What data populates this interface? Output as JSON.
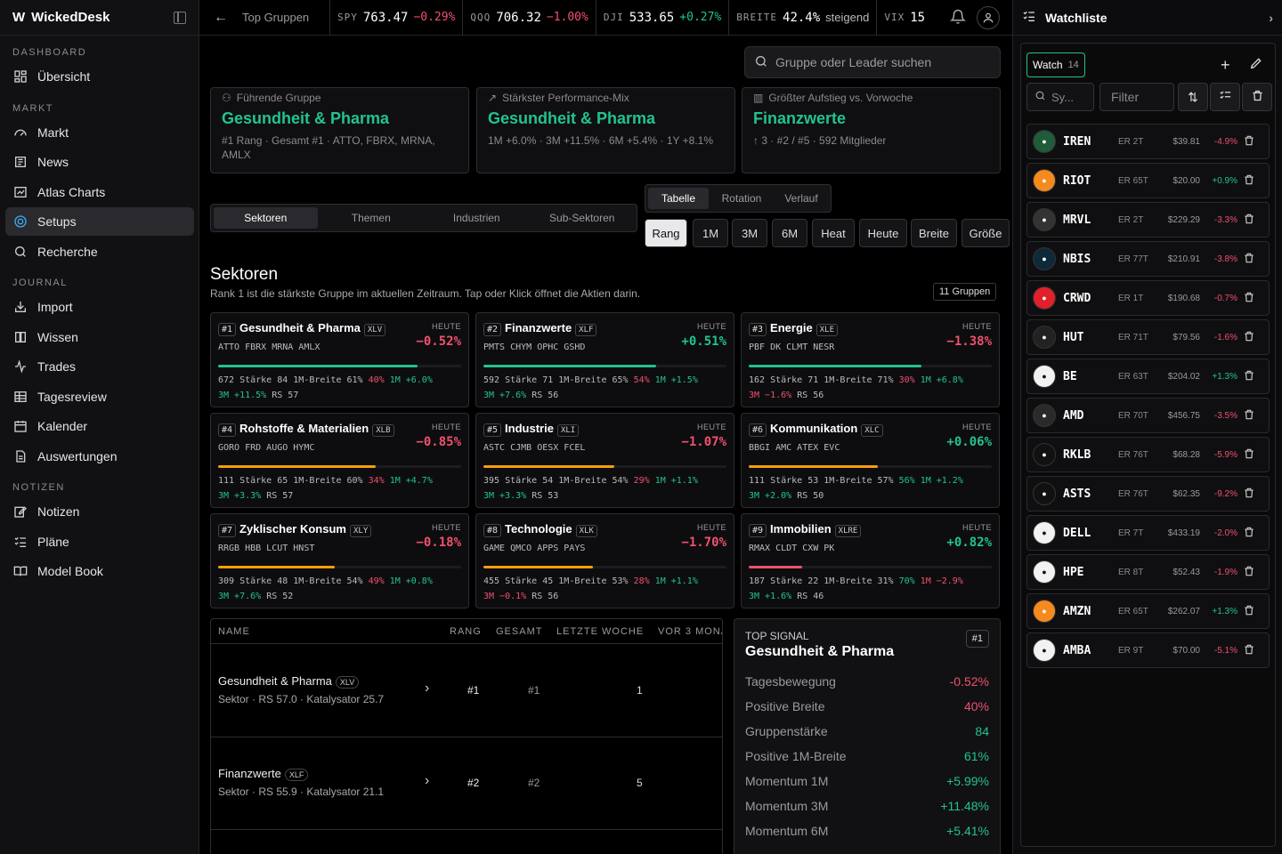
{
  "brand": {
    "name": "WickedDesk"
  },
  "sidebar": {
    "sections": [
      {
        "label": "DASHBOARD"
      },
      {
        "label": "MARKT"
      },
      {
        "label": "JOURNAL"
      },
      {
        "label": "NOTIZEN"
      }
    ],
    "items": [
      {
        "label": "Übersicht",
        "icon": "grid-icon"
      },
      {
        "label": "Markt",
        "icon": "gauge-icon"
      },
      {
        "label": "News",
        "icon": "newspaper-icon"
      },
      {
        "label": "Atlas Charts",
        "icon": "chart-icon"
      },
      {
        "label": "Setups",
        "icon": "target-icon"
      },
      {
        "label": "Recherche",
        "icon": "search-icon"
      },
      {
        "label": "Import",
        "icon": "import-icon"
      },
      {
        "label": "Wissen",
        "icon": "book-icon"
      },
      {
        "label": "Trades",
        "icon": "activity-icon"
      },
      {
        "label": "Tagesreview",
        "icon": "table-icon"
      },
      {
        "label": "Kalender",
        "icon": "calendar-icon"
      },
      {
        "label": "Auswertungen",
        "icon": "file-icon"
      },
      {
        "label": "Notizen",
        "icon": "edit-icon"
      },
      {
        "label": "Pläne",
        "icon": "list-icon"
      },
      {
        "label": "Model Book",
        "icon": "book-open-icon"
      }
    ]
  },
  "topbar": {
    "crumb": "Top Gruppen",
    "tickers": [
      {
        "sym": "SPY",
        "val": "763.47",
        "chg": "−0.29%",
        "dir": "neg"
      },
      {
        "sym": "QQQ",
        "val": "706.32",
        "chg": "−1.00%",
        "dir": "neg"
      },
      {
        "sym": "DJI",
        "val": "533.65",
        "chg": "+0.27%",
        "dir": "pos"
      },
      {
        "sym": "BREITE",
        "val": "42.4%",
        "chg": "steigend",
        "dir": "flat"
      },
      {
        "sym": "VIX",
        "val": "15",
        "chg": "",
        "dir": "flat"
      }
    ]
  },
  "search": {
    "placeholder": "Gruppe oder Leader suchen"
  },
  "highlights": [
    {
      "label": "Führende Gruppe",
      "title": "Gesundheit & Pharma",
      "sub": "#1 Rang · Gesamt #1 · ATTO, FBRX, MRNA, AMLX"
    },
    {
      "label": "Stärkster Performance-Mix",
      "title": "Gesundheit & Pharma",
      "sub": "1M +6.0% · 3M +11.5% · 6M +5.4% · 1Y +8.1%"
    },
    {
      "label": "Größter Aufstieg vs. Vorwoche",
      "title": "Finanzwerte",
      "sub": "↑ 3 · #2 / #5 · 592 Mitglieder"
    }
  ],
  "views": [
    "Tabelle",
    "Rotation",
    "Verlauf"
  ],
  "segments": [
    "Sektoren",
    "Themen",
    "Industrien",
    "Sub-Sektoren"
  ],
  "sorts": [
    "Rang",
    "1M",
    "3M",
    "6M",
    "Heat",
    "Heute",
    "Breite",
    "Größe"
  ],
  "section": {
    "title": "Sektoren",
    "desc": "Rank 1 ist die stärkste Gruppe im aktuellen Zeitraum. Tap oder Klick öffnet die Aktien darin.",
    "count": "11 Gruppen"
  },
  "cards": [
    {
      "rank": "#1",
      "name": "Gesundheit & Pharma",
      "etf": "XLV",
      "leaders": "ATTO FBRX MRNA AMLX",
      "today_label": "HEUTE",
      "chg": "−0.52%",
      "dir": "neg",
      "bar": 0.82,
      "barcol": "#22c38e",
      "l1a": "672 Stärke 84 1M-Breite 61%",
      "l1b": "40%",
      "l1c": "1M +6.0%",
      "l2a": "3M +11.5%",
      "l2b": "RS 57"
    },
    {
      "rank": "#2",
      "name": "Finanzwerte",
      "etf": "XLF",
      "leaders": "PMTS CHYM OPHC GSHD",
      "today_label": "HEUTE",
      "chg": "+0.51%",
      "dir": "pos",
      "bar": 0.71,
      "barcol": "#22c38e",
      "l1a": "592 Stärke 71 1M-Breite 65%",
      "l1b": "54%",
      "l1c": "1M +1.5%",
      "l2a": "3M +7.6%",
      "l2b": "RS 56"
    },
    {
      "rank": "#3",
      "name": "Energie",
      "etf": "XLE",
      "leaders": "PBF DK CLMT NESR",
      "today_label": "HEUTE",
      "chg": "−1.38%",
      "dir": "neg",
      "bar": 0.71,
      "barcol": "#22c38e",
      "l1a": "162 Stärke 71 1M-Breite 71%",
      "l1b": "30%",
      "l1c": "1M +6.8%",
      "l2a": "3M −1.6%",
      "l2b": "RS 56"
    },
    {
      "rank": "#4",
      "name": "Rohstoffe & Materialien",
      "etf": "XLB",
      "leaders": "GORO FRD AUGO HYMC",
      "today_label": "HEUTE",
      "chg": "−0.85%",
      "dir": "neg",
      "bar": 0.65,
      "barcol": "#f59e0b",
      "l1a": "111 Stärke 65 1M-Breite 60%",
      "l1b": "34%",
      "l1c": "1M +4.7%",
      "l2a": "3M +3.3%",
      "l2b": "RS 57"
    },
    {
      "rank": "#5",
      "name": "Industrie",
      "etf": "XLI",
      "leaders": "ASTC CJMB OESX FCEL",
      "today_label": "HEUTE",
      "chg": "−1.07%",
      "dir": "neg",
      "bar": 0.54,
      "barcol": "#f59e0b",
      "l1a": "395 Stärke 54 1M-Breite 54%",
      "l1b": "29%",
      "l1c": "1M +1.1%",
      "l2a": "3M +3.3%",
      "l2b": "RS 53"
    },
    {
      "rank": "#6",
      "name": "Kommunikation",
      "etf": "XLC",
      "leaders": "BBGI AMC ATEX EVC",
      "today_label": "HEUTE",
      "chg": "+0.06%",
      "dir": "pos",
      "bar": 0.53,
      "barcol": "#f59e0b",
      "l1a": "111 Stärke 53 1M-Breite 57%",
      "l1b": "56%",
      "l1c": "1M +1.2%",
      "l2a": "3M +2.0%",
      "l2b": "RS 50"
    },
    {
      "rank": "#7",
      "name": "Zyklischer Konsum",
      "etf": "XLY",
      "leaders": "RRGB HBB LCUT HNST",
      "today_label": "HEUTE",
      "chg": "−0.18%",
      "dir": "neg",
      "bar": 0.48,
      "barcol": "#f59e0b",
      "l1a": "309 Stärke 48 1M-Breite 54%",
      "l1b": "49%",
      "l1c": "1M +0.8%",
      "l2a": "3M +7.6%",
      "l2b": "RS 52"
    },
    {
      "rank": "#8",
      "name": "Technologie",
      "etf": "XLK",
      "leaders": "GAME QMCO APPS PAYS",
      "today_label": "HEUTE",
      "chg": "−1.70%",
      "dir": "neg",
      "bar": 0.45,
      "barcol": "#f59e0b",
      "l1a": "455 Stärke 45 1M-Breite 53%",
      "l1b": "28%",
      "l1c": "1M +1.1%",
      "l2a": "3M −0.1%",
      "l2b": "RS 56"
    },
    {
      "rank": "#9",
      "name": "Immobilien",
      "etf": "XLRE",
      "leaders": "RMAX CLDT CXW PK",
      "today_label": "HEUTE",
      "chg": "+0.82%",
      "dir": "pos",
      "bar": 0.22,
      "barcol": "#f0506e",
      "l1a": "187 Stärke 22 1M-Breite 31%",
      "l1b": "70%",
      "l1c": "1M −2.9%",
      "l2a": "3M +1.6%",
      "l2b": "RS 46"
    }
  ],
  "table": {
    "headers": [
      "NAME",
      "RANG",
      "GESAMT",
      "LETZTE WOCHE",
      "VOR 3 MONA"
    ],
    "rows": [
      {
        "name": "Gesundheit & Pharma",
        "etf": "XLV",
        "sub": "Sektor · RS 57.0 · Katalysator 25.7",
        "rang": "#1",
        "gesamt": "#1",
        "week": "1"
      },
      {
        "name": "Finanzwerte",
        "etf": "XLF",
        "sub": "Sektor · RS 55.9 · Katalysator 21.1",
        "rang": "#2",
        "gesamt": "#2",
        "week": "5"
      }
    ]
  },
  "signal": {
    "kicker": "TOP SIGNAL",
    "title": "Gesundheit & Pharma",
    "badge": "#1",
    "lines": [
      {
        "k": "Tagesbewegung",
        "v": "-0.52%",
        "dir": "neg"
      },
      {
        "k": "Positive Breite",
        "v": "40%",
        "dir": "neg"
      },
      {
        "k": "Gruppenstärke",
        "v": "84",
        "dir": "pos"
      },
      {
        "k": "Positive 1M-Breite",
        "v": "61%",
        "dir": "pos"
      },
      {
        "k": "Momentum 1M",
        "v": "+5.99%",
        "dir": "pos"
      },
      {
        "k": "Momentum 3M",
        "v": "+11.48%",
        "dir": "pos"
      },
      {
        "k": "Momentum 6M",
        "v": "+5.41%",
        "dir": "pos"
      }
    ]
  },
  "watchlist": {
    "title": "Watchliste",
    "tab": "Watch",
    "tab_count": "14",
    "sym_placeholder": "Sy...",
    "filter_placeholder": "Filter",
    "items": [
      {
        "sym": "IREN",
        "er": "ER 2T",
        "px": "$39.81",
        "pc": "-4.9%",
        "dir": "neg",
        "logo": "#1f5c3a"
      },
      {
        "sym": "RIOT",
        "er": "ER 65T",
        "px": "$20.00",
        "pc": "+0.9%",
        "dir": "pos",
        "logo": "#f58a1f"
      },
      {
        "sym": "MRVL",
        "er": "ER 2T",
        "px": "$229.29",
        "pc": "-3.3%",
        "dir": "neg",
        "logo": "#333"
      },
      {
        "sym": "NBIS",
        "er": "ER 77T",
        "px": "$210.91",
        "pc": "-3.8%",
        "dir": "neg",
        "logo": "#0e2a3a"
      },
      {
        "sym": "CRWD",
        "er": "ER 1T",
        "px": "$190.68",
        "pc": "-0.7%",
        "dir": "neg",
        "logo": "#e0202a"
      },
      {
        "sym": "HUT",
        "er": "ER 71T",
        "px": "$79.56",
        "pc": "-1.6%",
        "dir": "neg",
        "logo": "#222"
      },
      {
        "sym": "BE",
        "er": "ER 63T",
        "px": "$204.02",
        "pc": "+1.3%",
        "dir": "pos",
        "logo": "#f2f2f2"
      },
      {
        "sym": "AMD",
        "er": "ER 70T",
        "px": "$456.75",
        "pc": "-3.5%",
        "dir": "neg",
        "logo": "#2a2a2a"
      },
      {
        "sym": "RKLB",
        "er": "ER 76T",
        "px": "$68.28",
        "pc": "-5.9%",
        "dir": "neg",
        "logo": "#111"
      },
      {
        "sym": "ASTS",
        "er": "ER 76T",
        "px": "$62.35",
        "pc": "-9.2%",
        "dir": "neg",
        "logo": "#111"
      },
      {
        "sym": "DELL",
        "er": "ER 7T",
        "px": "$433.19",
        "pc": "-2.0%",
        "dir": "neg",
        "logo": "#f2f2f2"
      },
      {
        "sym": "HPE",
        "er": "ER 8T",
        "px": "$52.43",
        "pc": "-1.9%",
        "dir": "neg",
        "logo": "#f2f2f2"
      },
      {
        "sym": "AMZN",
        "er": "ER 65T",
        "px": "$262.07",
        "pc": "+1.3%",
        "dir": "pos",
        "logo": "#f58a1f"
      },
      {
        "sym": "AMBA",
        "er": "ER 9T",
        "px": "$70.00",
        "pc": "-5.1%",
        "dir": "neg",
        "logo": "#f2f2f2"
      }
    ]
  }
}
